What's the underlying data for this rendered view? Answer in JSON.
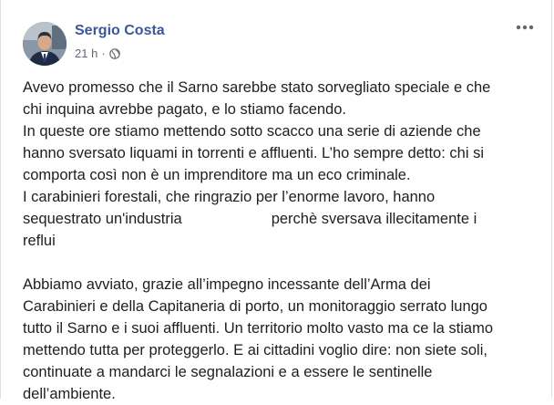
{
  "post": {
    "author": "Sergio Costa",
    "time": "21 h",
    "separator": "·",
    "privacy_icon": "globe-icon",
    "more_icon": "more-options-icon",
    "paragraph1": [
      "Avevo promesso che il Sarno sarebbe stato sorvegliato speciale e che",
      "chi inquina avrebbe pagato, e lo stiamo facendo.",
      "In queste ore stiamo mettendo sotto scacco una serie di aziende che",
      "hanno sversato liquami in torrenti e affluenti. L’ho sempre detto: chi si",
      "comporta così non è un imprenditore ma un eco criminale.",
      "I carabinieri forestali, che ringrazio per l’enorme lavoro, hanno"
    ],
    "line7_before": "sequestrato un'industria",
    "line7_after": "perchè sversava illecitamente i",
    "line8": "reflui",
    "paragraph2": [
      "Abbiamo avviato, grazie all’impegno incessante dell’Arma dei",
      "Carabinieri e della Capitaneria di porto, un monitoraggio serrato lungo",
      "tutto il Sarno e i suoi affluenti. Un territorio molto vasto ma ce la stiamo",
      "mettendo tutta per proteggerlo. E ai cittadini voglio dire: non siete soli,",
      "continuate a mandarci le segnalazioni e a essere le sentinelle",
      "dell’ambiente."
    ]
  },
  "colors": {
    "author_link": "#385898",
    "meta_text": "#616770",
    "body_text": "#1c1e21"
  }
}
